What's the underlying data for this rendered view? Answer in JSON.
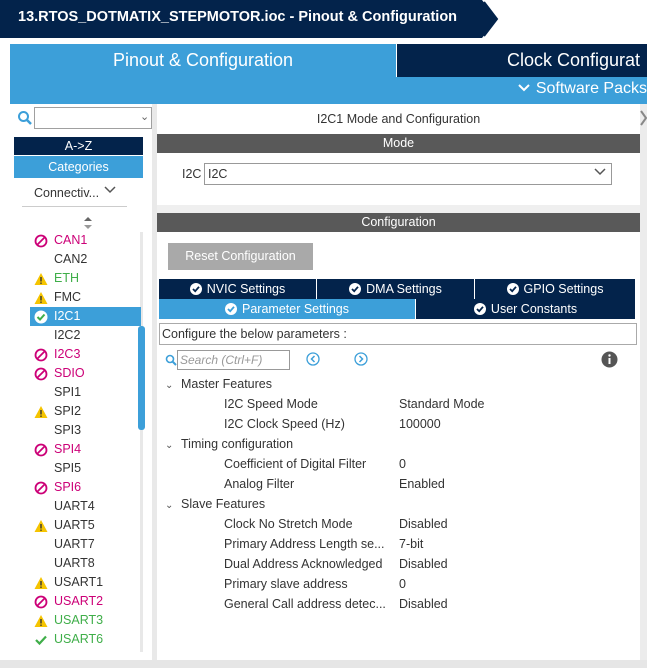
{
  "title": "13.RTOS_DOTMATIX_STEPMOTOR.ioc - Pinout & Configuration",
  "tabs": {
    "pinout": "Pinout & Configuration",
    "clock": "Clock Configurat"
  },
  "software_packs": "Software Packs",
  "sidebar": {
    "search_value": "",
    "az_label": "A->Z",
    "categories_label": "Categories",
    "category_select": "Connectiv...",
    "peripherals": [
      {
        "name": "CAN1",
        "status": "disabled",
        "color": "#cc0077"
      },
      {
        "name": "CAN2",
        "status": "none",
        "color": "#333333"
      },
      {
        "name": "ETH",
        "status": "warning",
        "color": "#3fae49"
      },
      {
        "name": "FMC",
        "status": "warning",
        "color": "#333333"
      },
      {
        "name": "I2C1",
        "status": "ok-selected",
        "color": "#ffffff"
      },
      {
        "name": "I2C2",
        "status": "none",
        "color": "#333333"
      },
      {
        "name": "I2C3",
        "status": "disabled",
        "color": "#cc0077"
      },
      {
        "name": "SDIO",
        "status": "disabled",
        "color": "#cc0077"
      },
      {
        "name": "SPI1",
        "status": "none",
        "color": "#333333"
      },
      {
        "name": "SPI2",
        "status": "warning",
        "color": "#333333"
      },
      {
        "name": "SPI3",
        "status": "none",
        "color": "#333333"
      },
      {
        "name": "SPI4",
        "status": "disabled",
        "color": "#cc0077"
      },
      {
        "name": "SPI5",
        "status": "none",
        "color": "#333333"
      },
      {
        "name": "SPI6",
        "status": "disabled",
        "color": "#cc0077"
      },
      {
        "name": "UART4",
        "status": "none",
        "color": "#333333"
      },
      {
        "name": "UART5",
        "status": "warning",
        "color": "#333333"
      },
      {
        "name": "UART7",
        "status": "none",
        "color": "#333333"
      },
      {
        "name": "UART8",
        "status": "none",
        "color": "#333333"
      },
      {
        "name": "USART1",
        "status": "warning",
        "color": "#333333"
      },
      {
        "name": "USART2",
        "status": "disabled",
        "color": "#cc0077"
      },
      {
        "name": "USART3",
        "status": "warning",
        "color": "#3fae49"
      },
      {
        "name": "USART6",
        "status": "check",
        "color": "#3fae49"
      }
    ]
  },
  "mode": {
    "header": "I2C1 Mode and Configuration",
    "bar": "Mode",
    "i2c_label": "I2C",
    "i2c_value": "I2C"
  },
  "configuration": {
    "bar": "Configuration",
    "reset_label": "Reset Configuration",
    "settings_tabs": {
      "nvic": "NVIC Settings",
      "dma": "DMA Settings",
      "gpio": "GPIO Settings",
      "param": "Parameter Settings",
      "user": "User Constants"
    },
    "description": "Configure the below parameters :",
    "search_placeholder": "Search (Ctrl+F)",
    "groups": [
      {
        "name": "Master Features",
        "params": [
          {
            "name": "I2C Speed Mode",
            "value": "Standard Mode"
          },
          {
            "name": "I2C Clock Speed (Hz)",
            "value": "100000"
          }
        ]
      },
      {
        "name": "Timing configuration",
        "params": [
          {
            "name": "Coefficient of Digital Filter",
            "value": "0"
          },
          {
            "name": "Analog Filter",
            "value": "Enabled"
          }
        ]
      },
      {
        "name": "Slave Features",
        "params": [
          {
            "name": "Clock No Stretch Mode",
            "value": "Disabled"
          },
          {
            "name": "Primary Address Length se...",
            "value": "7-bit"
          },
          {
            "name": "Dual Address Acknowledged",
            "value": "Disabled"
          },
          {
            "name": "Primary slave address",
            "value": "0"
          },
          {
            "name": "General Call address detec...",
            "value": "Disabled"
          }
        ]
      }
    ]
  },
  "colors": {
    "navy": "#03234b",
    "blue": "#3c9fd9",
    "gray_bar": "#595959",
    "ok_green": "#3fae49",
    "warn_yellow": "#f5c400",
    "disabled_magenta": "#cc0077"
  }
}
